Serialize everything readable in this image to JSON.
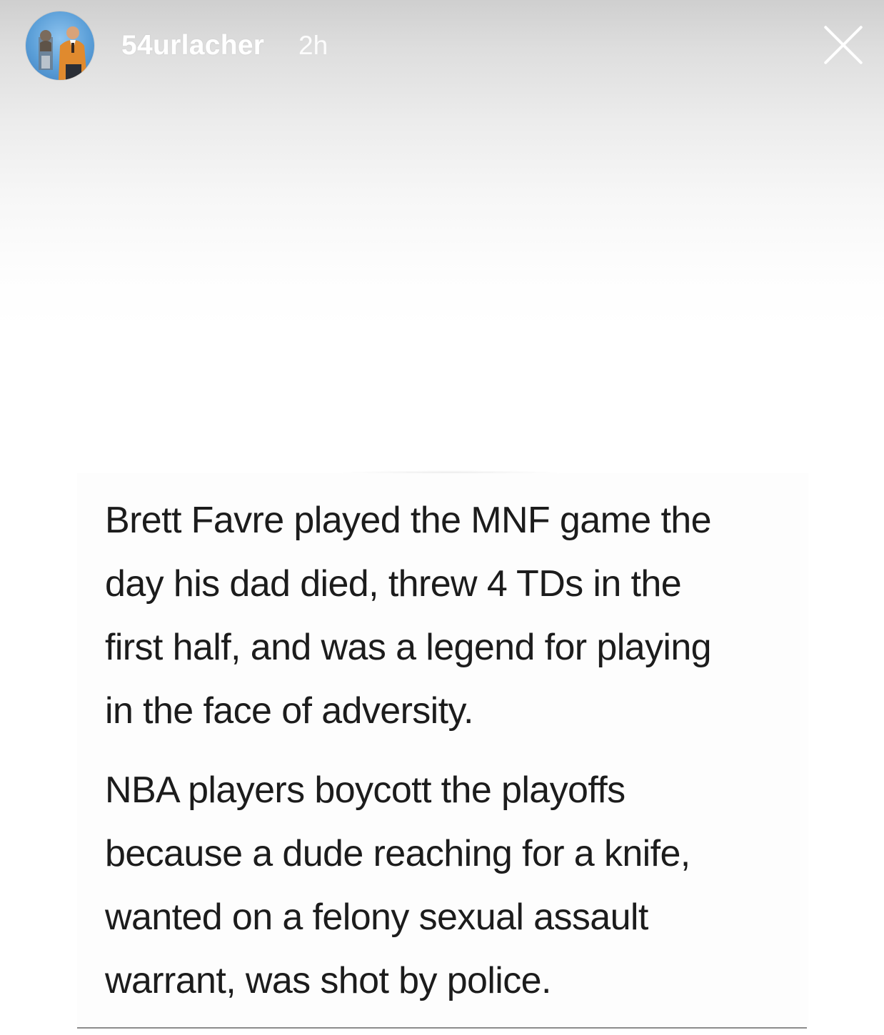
{
  "story": {
    "username": "54urlacher",
    "time_ago": "2h",
    "avatar_icon": "profile-avatar-icon",
    "close_icon": "close-icon"
  },
  "post": {
    "paragraph_1_lines": [
      "Brett Favre played the MNF game the",
      "day his dad died, threw 4 TDs in the",
      "first half, and was a legend for playing",
      "in the face of adversity."
    ],
    "paragraph_2_lines": [
      "NBA players boycott the playoffs",
      "because a dude reaching for a knife,",
      "wanted on a felony sexual assault",
      "warrant, was shot by police."
    ]
  },
  "colors": {
    "header_gradient_top": "#cfcfcf",
    "text_color": "#1c1c1c",
    "header_text": "#ffffff",
    "avatar_blue": "#5b9fd8"
  }
}
